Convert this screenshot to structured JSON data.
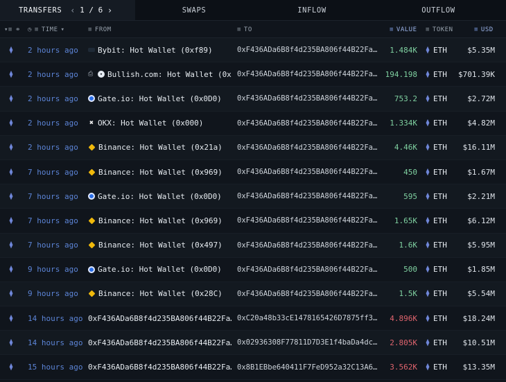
{
  "tabs": {
    "transfers": "TRANSFERS",
    "page_current": "1",
    "page_sep": "/",
    "page_total": "6",
    "swaps": "SWAPS",
    "inflow": "INFLOW",
    "outflow": "OUTFLOW"
  },
  "columns": {
    "time": "TIME",
    "from": "FROM",
    "to": "TO",
    "value": "VALUE",
    "token": "TOKEN",
    "usd": "USD"
  },
  "rows": [
    {
      "time": "2 hours ago",
      "from": "Bybit: Hot Wallet (0xf89)",
      "from_icon": "bybit-icon",
      "to": "0xF436ADa6B8f4d235BA806f44B22Fa…",
      "value": "1.484K",
      "dir": "pos",
      "token": "ETH",
      "usd": "$5.35M"
    },
    {
      "time": "2 hours ago",
      "from": "Bullish.com: Hot Wallet (0x…",
      "from_icon": "bullish-icon",
      "to": "0xF436ADa6B8f4d235BA806f44B22Fa…",
      "value": "194.198",
      "dir": "pos",
      "token": "ETH",
      "usd": "$701.39K"
    },
    {
      "time": "2 hours ago",
      "from": "Gate.io: Hot Wallet (0x0D0)",
      "from_icon": "gateio-icon",
      "to": "0xF436ADa6B8f4d235BA806f44B22Fa…",
      "value": "753.2",
      "dir": "pos",
      "token": "ETH",
      "usd": "$2.72M"
    },
    {
      "time": "2 hours ago",
      "from": "OKX: Hot Wallet (0x000)",
      "from_icon": "okx-icon",
      "to": "0xF436ADa6B8f4d235BA806f44B22Fa…",
      "value": "1.334K",
      "dir": "pos",
      "token": "ETH",
      "usd": "$4.82M"
    },
    {
      "time": "2 hours ago",
      "from": "Binance: Hot Wallet (0x21a)",
      "from_icon": "binance-icon",
      "to": "0xF436ADa6B8f4d235BA806f44B22Fa…",
      "value": "4.46K",
      "dir": "pos",
      "token": "ETH",
      "usd": "$16.11M"
    },
    {
      "time": "7 hours ago",
      "from": "Binance: Hot Wallet (0x969)",
      "from_icon": "binance-icon",
      "to": "0xF436ADa6B8f4d235BA806f44B22Fa…",
      "value": "450",
      "dir": "pos",
      "token": "ETH",
      "usd": "$1.67M"
    },
    {
      "time": "7 hours ago",
      "from": "Gate.io: Hot Wallet (0x0D0)",
      "from_icon": "gateio-icon",
      "to": "0xF436ADa6B8f4d235BA806f44B22Fa…",
      "value": "595",
      "dir": "pos",
      "token": "ETH",
      "usd": "$2.21M"
    },
    {
      "time": "7 hours ago",
      "from": "Binance: Hot Wallet (0x969)",
      "from_icon": "binance-icon",
      "to": "0xF436ADa6B8f4d235BA806f44B22Fa…",
      "value": "1.65K",
      "dir": "pos",
      "token": "ETH",
      "usd": "$6.12M"
    },
    {
      "time": "7 hours ago",
      "from": "Binance: Hot Wallet (0x497)",
      "from_icon": "binance-icon",
      "to": "0xF436ADa6B8f4d235BA806f44B22Fa…",
      "value": "1.6K",
      "dir": "pos",
      "token": "ETH",
      "usd": "$5.95M"
    },
    {
      "time": "9 hours ago",
      "from": "Gate.io: Hot Wallet (0x0D0)",
      "from_icon": "gateio-icon",
      "to": "0xF436ADa6B8f4d235BA806f44B22Fa…",
      "value": "500",
      "dir": "pos",
      "token": "ETH",
      "usd": "$1.85M"
    },
    {
      "time": "9 hours ago",
      "from": "Binance: Hot Wallet (0x28C)",
      "from_icon": "binance-icon",
      "to": "0xF436ADa6B8f4d235BA806f44B22Fa…",
      "value": "1.5K",
      "dir": "pos",
      "token": "ETH",
      "usd": "$5.54M"
    },
    {
      "time": "14 hours ago",
      "from": "0xF436ADa6B8f4d235BA806f44B22Fa…",
      "from_icon": "",
      "to": "0xC20a48b33cE1478165426D7875ff3…",
      "value": "4.896K",
      "dir": "neg",
      "token": "ETH",
      "usd": "$18.24M"
    },
    {
      "time": "14 hours ago",
      "from": "0xF436ADa6B8f4d235BA806f44B22Fa…",
      "from_icon": "",
      "to": "0x02936308F77811D7D3E1f4baDa4dc…",
      "value": "2.805K",
      "dir": "neg",
      "token": "ETH",
      "usd": "$10.51M"
    },
    {
      "time": "15 hours ago",
      "from": "0xF436ADa6B8f4d235BA806f44B22Fa…",
      "from_icon": "",
      "to": "0x8B1EBbe640411F7FeD952a32C13A6…",
      "value": "3.562K",
      "dir": "neg",
      "token": "ETH",
      "usd": "$13.35M"
    }
  ]
}
